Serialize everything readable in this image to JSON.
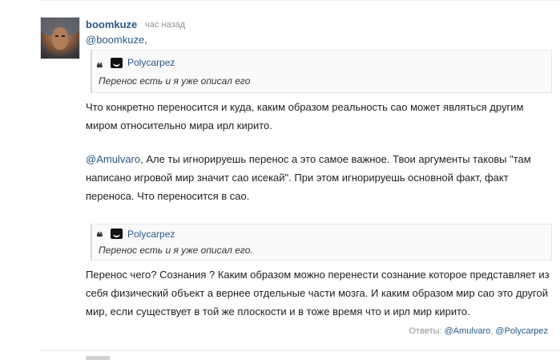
{
  "comment": {
    "author": "boomkuze",
    "time": "час назад",
    "mention": "@boomkuze,",
    "quote1": {
      "author": "Polycarpez",
      "text": "Перенос есть и я уже описал его"
    },
    "paragraph1": "Что конкретно переносится и куда, каким образом реальность сао может являться другим миром относительно мира ирл кирито.",
    "paragraph2_mention": "@Amulvaro",
    "paragraph2_text": ", Але ты игнорируешь перенос а это самое важное. Твои аргументы таковы \"там написано игровой мир значит сао исекай\". При этом игнорируешь основной факт, факт переноса. Что переносится в сао.",
    "quote2": {
      "author": "Polycarpez",
      "text": "Перенос есть и я уже описал его."
    },
    "paragraph3": "Перенос чего? Сознания ? Каким образом можно перенести сознание которое представляет из себя физический объект а вернее отдельные части мозга. И каким образом мир сао это другой мир, если существует в той же плоскости и в тоже время что и ирл мир кирито.",
    "replies_label": "Ответы:",
    "reply1": "@Amulvaro",
    "reply_sep": ",",
    "reply2": "@Polycarpez"
  }
}
